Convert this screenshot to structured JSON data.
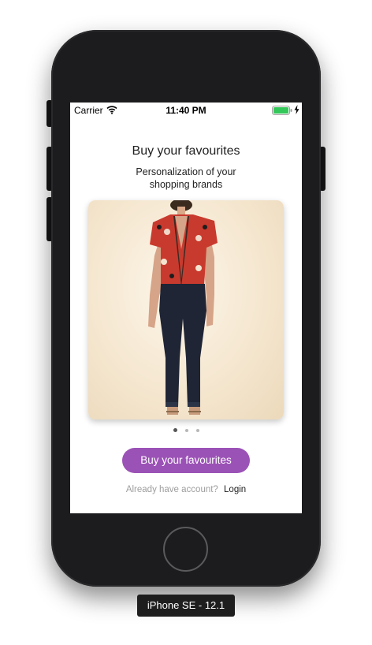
{
  "device": {
    "label": "iPhone SE - 12.1"
  },
  "status_bar": {
    "carrier": "Carrier",
    "time": "11:40 PM",
    "icons": [
      "wifi-icon",
      "battery-icon",
      "charging-icon"
    ],
    "battery_color": "#34c759"
  },
  "onboarding": {
    "title": "Buy your favourites",
    "subtitle": "Personalization of your shopping brands",
    "carousel": {
      "image": "model-outfit-photo",
      "page_count": 3,
      "active_page": 1
    },
    "cta_label": "Buy your favourites",
    "account_prompt": "Already have account?",
    "login_label": "Login"
  },
  "colors": {
    "accent": "#9b52b6",
    "phone_body": "#1c1c1e"
  }
}
